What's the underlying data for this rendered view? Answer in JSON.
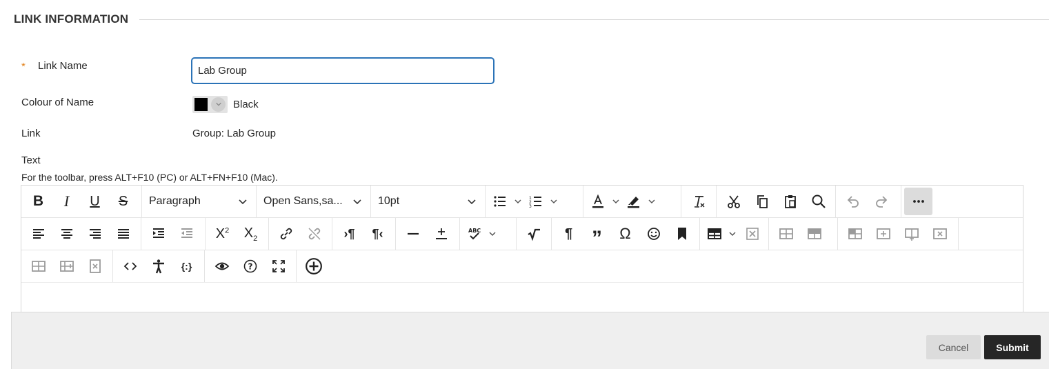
{
  "section": {
    "title": "LINK INFORMATION"
  },
  "form": {
    "required_marker": "*",
    "link_name_label": "Link Name",
    "link_name_value": "Lab Group",
    "colour_label": "Colour of Name",
    "colour_value": "Black",
    "colour_hex": "#000000",
    "link_label": "Link",
    "link_value": "Group: Lab Group",
    "text_label": "Text",
    "toolbar_hint": "For the toolbar, press ALT+F10 (PC) or ALT+FN+F10 (Mac)."
  },
  "editor": {
    "block_format": "Paragraph",
    "font_family": "Open Sans,sa...",
    "font_size": "10pt"
  },
  "footer": {
    "cancel_label": "Cancel",
    "submit_label": "Submit"
  },
  "colors": {
    "accent": "#2b73b7",
    "required": "#e2821b",
    "submit_bg": "#262626"
  }
}
